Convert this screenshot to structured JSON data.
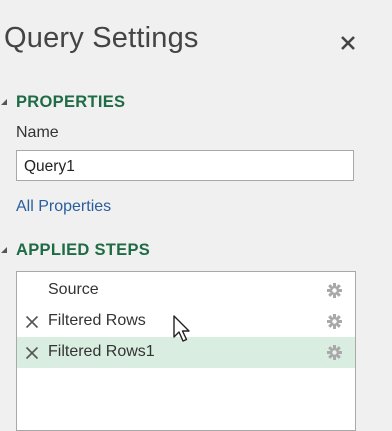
{
  "panel": {
    "title": "Query Settings"
  },
  "properties": {
    "header": "PROPERTIES",
    "name_label": "Name",
    "name_value": "Query1",
    "all_properties_link": "All Properties"
  },
  "applied_steps": {
    "header": "APPLIED STEPS",
    "steps": [
      {
        "label": "Source",
        "has_delete": false,
        "selected": false,
        "icon": "gear-icon"
      },
      {
        "label": "Filtered Rows",
        "has_delete": true,
        "selected": false,
        "icon": "gear-icon"
      },
      {
        "label": "Filtered Rows1",
        "has_delete": true,
        "selected": true,
        "icon": "gear-icon"
      }
    ]
  },
  "colors": {
    "section_header": "#1f6b45",
    "link": "#2a5d9e",
    "selected_row": "#d9eee0",
    "panel_bg": "#f0f0f0"
  }
}
